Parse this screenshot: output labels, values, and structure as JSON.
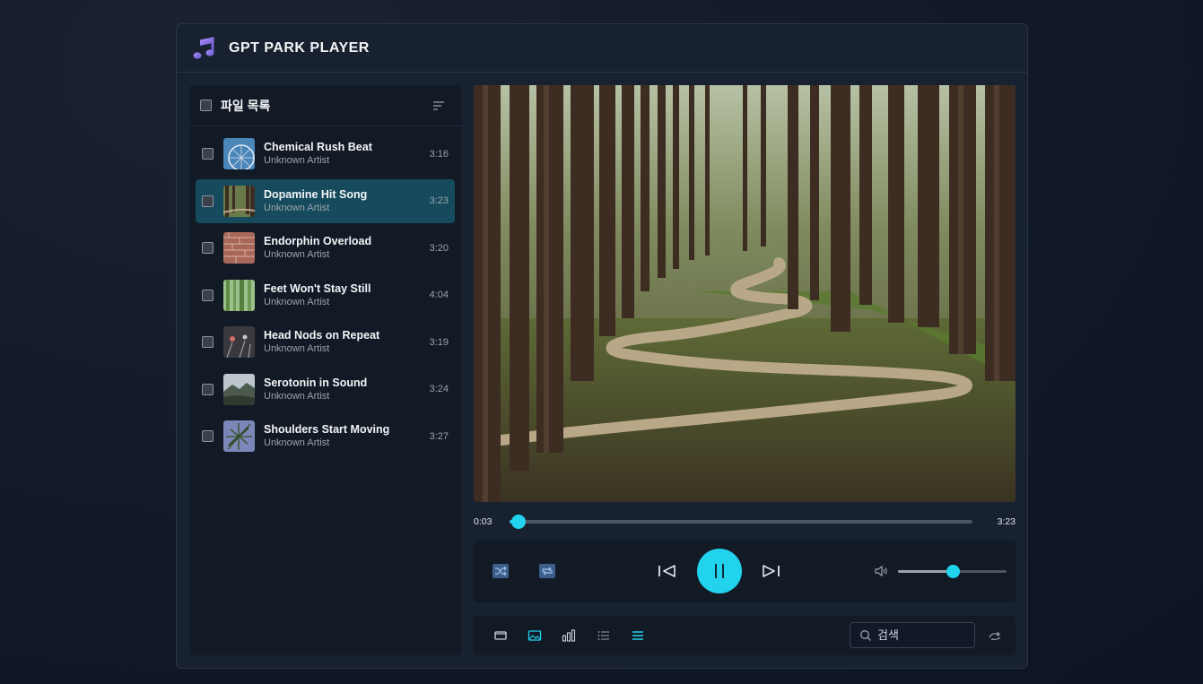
{
  "app": {
    "title": "GPT PARK PLAYER"
  },
  "sidebar": {
    "title": "파일 목록",
    "tracks": [
      {
        "title": "Chemical Rush Beat",
        "artist": "Unknown Artist",
        "duration": "3:16",
        "active": false
      },
      {
        "title": "Dopamine Hit Song",
        "artist": "Unknown Artist",
        "duration": "3:23",
        "active": true
      },
      {
        "title": "Endorphin Overload",
        "artist": "Unknown Artist",
        "duration": "3:20",
        "active": false
      },
      {
        "title": "Feet Won't Stay Still",
        "artist": "Unknown Artist",
        "duration": "4:04",
        "active": false
      },
      {
        "title": "Head Nods on Repeat",
        "artist": "Unknown Artist",
        "duration": "3:19",
        "active": false
      },
      {
        "title": "Serotonin in Sound",
        "artist": "Unknown Artist",
        "duration": "3:24",
        "active": false
      },
      {
        "title": "Shoulders Start Moving",
        "artist": "Unknown Artist",
        "duration": "3:27",
        "active": false
      }
    ]
  },
  "player": {
    "current_time": "0:03",
    "total_time": "3:23",
    "progress_fraction": 0.02,
    "volume_fraction": 0.5,
    "state": "playing"
  },
  "toolbar": {
    "search_placeholder": "검색"
  },
  "colors": {
    "accent": "#22d3ee",
    "active_row": "#164b5d",
    "panel": "#121a26",
    "app_bg": "#182130"
  },
  "icons": [
    "music-note-icon",
    "sort-icon",
    "shuffle-icon",
    "repeat-icon",
    "previous-icon",
    "pause-icon",
    "next-icon",
    "volume-icon",
    "window-icon",
    "image-icon",
    "bar-chart-icon",
    "list-icon",
    "menu-icon",
    "search-icon",
    "refresh-icon"
  ]
}
